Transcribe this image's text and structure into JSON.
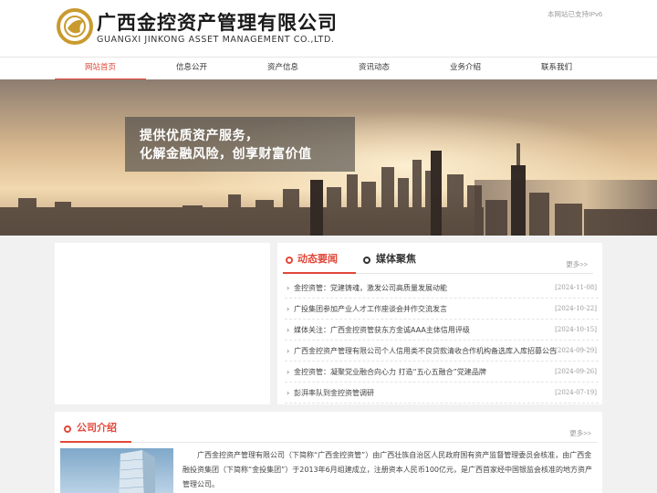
{
  "header": {
    "logo_cn": "广西金控资产管理有限公司",
    "logo_en": "GUANGXI JINKONG ASSET MANAGEMENT CO.,LTD.",
    "ipv6_notice": "本网站已支持IPv6",
    "brand_color": "#e2483a",
    "logo_gold": "#c99a2e"
  },
  "nav": {
    "items": [
      {
        "label": "网站首页",
        "active": true
      },
      {
        "label": "信息公开",
        "active": false
      },
      {
        "label": "资产信息",
        "active": false
      },
      {
        "label": "资讯动态",
        "active": false
      },
      {
        "label": "业务介绍",
        "active": false
      },
      {
        "label": "联系我们",
        "active": false
      }
    ]
  },
  "banner": {
    "line1": "提供优质资产服务，",
    "line2": "化解金融风险，创享财富价值"
  },
  "news": {
    "tab_active": "动态要闻",
    "tab_inactive": "媒体聚焦",
    "more": "更多>>",
    "items": [
      {
        "title": "金控资管：党建铸魂，激发公司高质量发展动能",
        "date": "[2024-11-08]"
      },
      {
        "title": "广投集团参加产业人才工作座谈会并作交流发言",
        "date": "[2024-10-22]"
      },
      {
        "title": "媒体关注：广西金控资管获东方金诚AAA主体信用评级",
        "date": "[2024-10-15]"
      },
      {
        "title": "广西金控资产管理有限公司个人信用类不良贷款清收合作机构备选库入库招募公告",
        "date": "[2024-09-29]"
      },
      {
        "title": "金控资管：凝聚党业融合向心力 打造“五心五融合”党建品牌",
        "date": "[2024-09-26]"
      },
      {
        "title": "彭湃率队到金控资管调研",
        "date": "[2024-07-19]"
      }
    ]
  },
  "intro": {
    "title": "公司介绍",
    "more": "更多>>",
    "text": "广西金控资产管理有限公司（下简称“广西金控资管”）由广西壮族自治区人民政府国有资产监督管理委员会核准，由广西金融投资集团（下简称“金投集团”）于2013年6月组建成立，注册资本人民币100亿元，是广西首家经中国银监会核准的地方资产管理公司。"
  }
}
